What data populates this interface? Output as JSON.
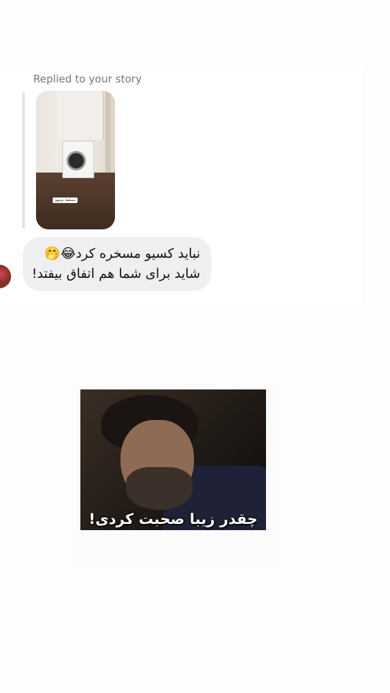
{
  "reply": {
    "caption": "Replied to your story",
    "story_tag": "مسقط دوشهر"
  },
  "message": {
    "line1": "نباید کسیو مسخره کرد😂🤭",
    "line2": "شاید برای شما هم اتفاق بیفتد!"
  },
  "gif": {
    "caption": "چقدر زیبا صحبت کردی!"
  }
}
